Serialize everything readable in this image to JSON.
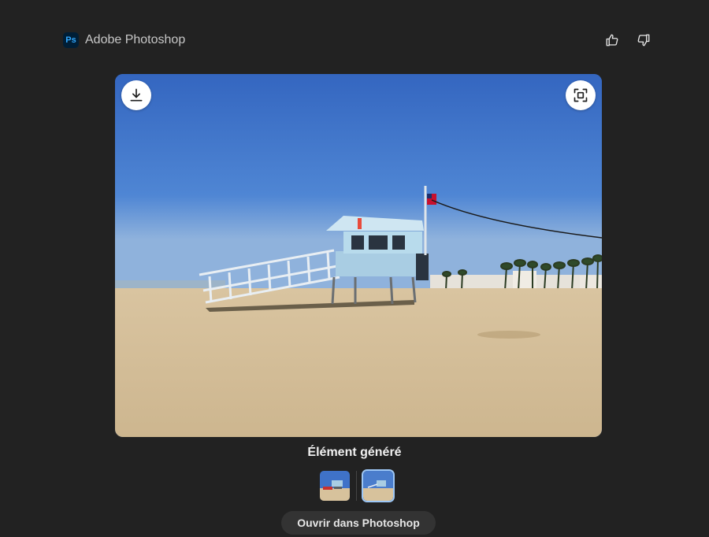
{
  "header": {
    "logo_text": "Ps",
    "app_name": "Adobe Photoshop"
  },
  "feedback": {
    "like_icon": "thumbs-up-icon",
    "dislike_icon": "thumbs-down-icon"
  },
  "image": {
    "download_icon": "download-icon",
    "fullscreen_icon": "fullscreen-icon"
  },
  "caption": "Élément généré",
  "thumbnails": [
    {
      "selected": false
    },
    {
      "selected": true
    }
  ],
  "open_button_label": "Ouvrir dans Photoshop",
  "colors": {
    "background": "#222222",
    "accent": "#31a8ff",
    "selected_outline": "#9cc6f5"
  }
}
